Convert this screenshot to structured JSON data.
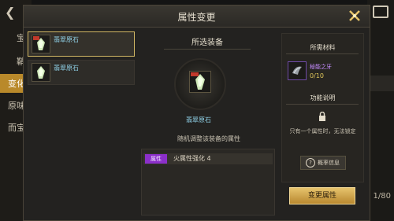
{
  "background": {
    "back_icon": "back-arrow-icon",
    "side_tabs": [
      "宝",
      "鞘",
      "变化",
      "原味",
      "而宝"
    ],
    "page_indicator": "1/80"
  },
  "dialog": {
    "title": "属性变更",
    "close_icon": "close-x-icon"
  },
  "item_list": [
    {
      "name": "翡翠原石",
      "selected": true
    },
    {
      "name": "翡翠原石",
      "selected": false
    }
  ],
  "selected_equipment": {
    "section_title": "所选装备",
    "name": "翡翠原石",
    "description": "随机调整该装备的属性",
    "attributes": [
      {
        "tag": "属性",
        "text": "火属性强化 4"
      }
    ]
  },
  "materials": {
    "section_title": "所需材料",
    "item_name": "秘能之牙",
    "count": "0/10"
  },
  "function_info": {
    "section_title": "功能说明",
    "note": "只有一个属性时，无法锁定",
    "probability_button": "概率信息"
  },
  "change_button": "变更属性",
  "colors": {
    "accent_gold": "#d1b764",
    "item_blue": "#8fd0e6",
    "material_purple": "#c58cff",
    "attr_tag_purple": "#8b2fc9"
  }
}
